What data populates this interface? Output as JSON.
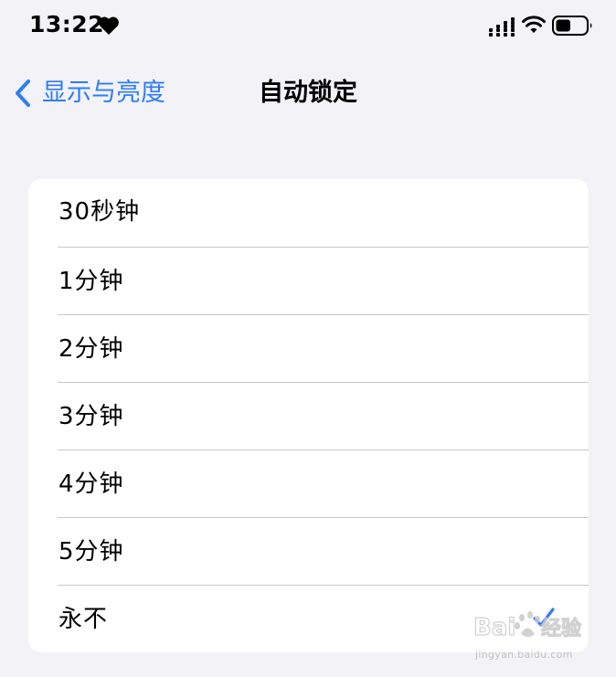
{
  "status_bar": {
    "time": "13:22",
    "icons": [
      "heart-icon",
      "signal-icon",
      "wifi-icon",
      "battery-icon"
    ],
    "battery_level": 0.5
  },
  "nav": {
    "back_label": "显示与亮度",
    "title": "自动锁定",
    "accent_color": "#2f7df6"
  },
  "options": {
    "items": [
      {
        "label": "30秒钟",
        "selected": false
      },
      {
        "label": "1分钟",
        "selected": false
      },
      {
        "label": "2分钟",
        "selected": false
      },
      {
        "label": "3分钟",
        "selected": false
      },
      {
        "label": "4分钟",
        "selected": false
      },
      {
        "label": "5分钟",
        "selected": false
      },
      {
        "label": "永不",
        "selected": true
      }
    ]
  },
  "watermark": {
    "logo_text": "Bai百度经验",
    "url": "jingyan.baidu.com"
  }
}
